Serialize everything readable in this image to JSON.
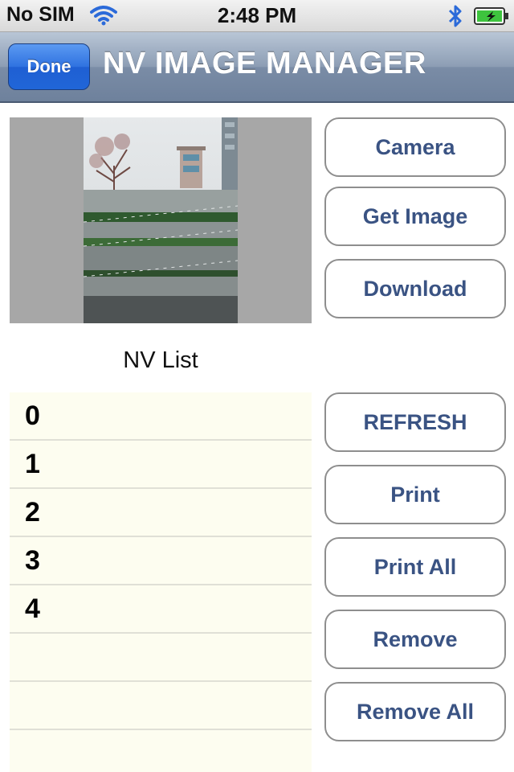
{
  "status_bar": {
    "carrier": "No SIM",
    "time": "2:48 PM",
    "icons": [
      "wifi-icon",
      "bluetooth-icon",
      "battery-charging-icon"
    ]
  },
  "nav": {
    "done_label": "Done",
    "title": "NV IMAGE MANAGER"
  },
  "top_buttons": [
    "Camera",
    "Get Image",
    "Download"
  ],
  "list": {
    "label": "NV List",
    "items": [
      "0",
      "1",
      "2",
      "3",
      "4"
    ],
    "empty_rows": 3
  },
  "side_buttons": [
    "REFRESH",
    "Print",
    "Print All",
    "Remove",
    "Remove All"
  ],
  "colors": {
    "button_text": "#3a5383",
    "list_background": "#fdfdf0",
    "done_button": "#2f72e0",
    "image_panel_background": "#a7a7a7"
  }
}
